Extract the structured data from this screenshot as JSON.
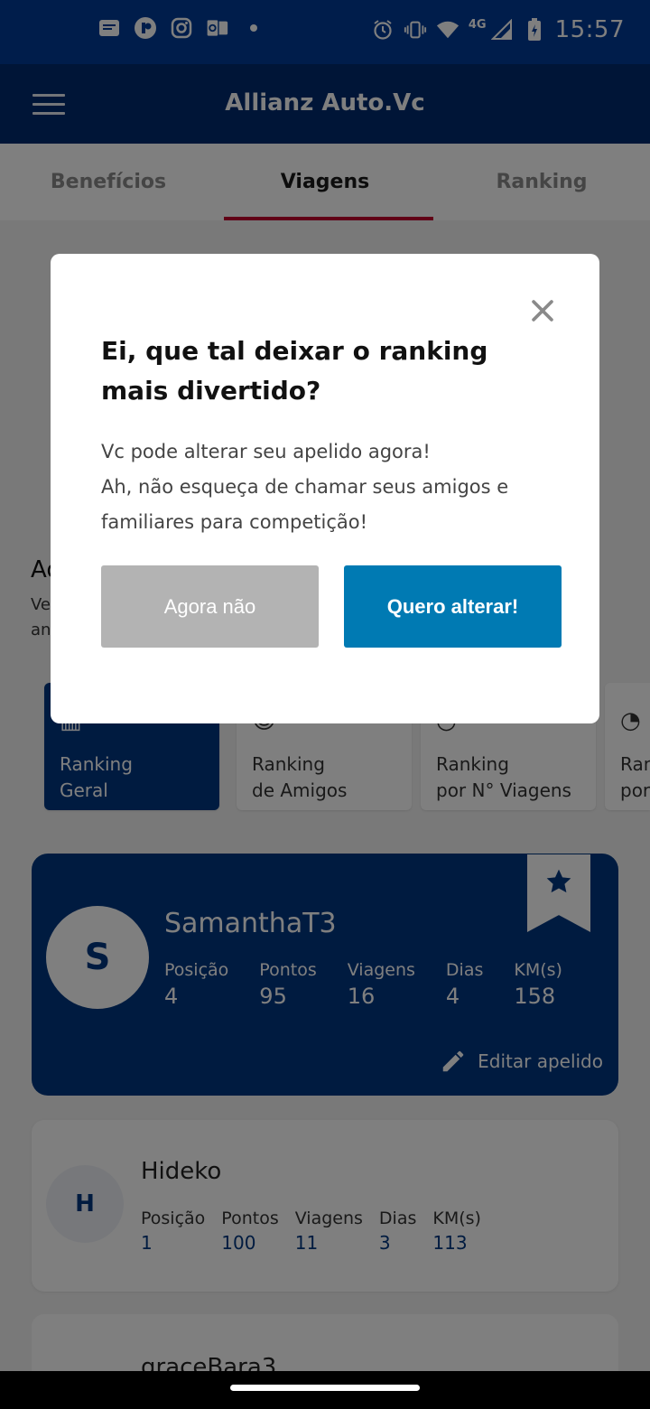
{
  "status_bar": {
    "time": "15:57",
    "network": "4G",
    "left_icons": [
      "notification-icon",
      "app-icon",
      "instagram-icon",
      "outlook-icon",
      "dot-icon"
    ],
    "right_icons": [
      "alarm-icon",
      "vibrate-icon",
      "wifi-icon",
      "signal-icon",
      "battery-charging-icon"
    ]
  },
  "app_bar": {
    "title": "Allianz Auto.Vc"
  },
  "tabs": [
    {
      "label": "Benefícios",
      "active": false
    },
    {
      "label": "Viagens",
      "active": true
    },
    {
      "label": "Ranking",
      "active": false
    }
  ],
  "background": {
    "section_title": "Ad",
    "section_sub": "Ve an"
  },
  "ranking_filters": [
    {
      "line1": "Ranking",
      "line2": "Geral",
      "active": true
    },
    {
      "line1": "Ranking",
      "line2": "de Amigos",
      "active": false
    },
    {
      "line1": "Ranking",
      "line2": "por N° Viagens",
      "active": false
    },
    {
      "line1": "Ran",
      "line2": "por",
      "active": false
    }
  ],
  "user_card": {
    "initial": "S",
    "name": "SamanthaT3",
    "stats": [
      {
        "label": "Posição",
        "value": "4"
      },
      {
        "label": "Pontos",
        "value": "95"
      },
      {
        "label": "Viagens",
        "value": "16"
      },
      {
        "label": "Dias",
        "value": "4"
      },
      {
        "label": "KM(s)",
        "value": "158"
      }
    ],
    "edit_label": "Editar apelido"
  },
  "other_user": {
    "initial": "H",
    "name": "Hideko",
    "stats": [
      {
        "label": "Posição",
        "value": "1"
      },
      {
        "label": "Pontos",
        "value": "100"
      },
      {
        "label": "Viagens",
        "value": "11"
      },
      {
        "label": "Dias",
        "value": "3"
      },
      {
        "label": "KM(s)",
        "value": "113"
      }
    ]
  },
  "third_user": {
    "name": "graceBara3"
  },
  "dialog": {
    "title": "Ei, que tal deixar o ranking mais divertido?",
    "body_line1": "Vc pode alterar seu apelido agora!",
    "body_line2": "Ah, não esqueça de chamar seus amigos e familiares para competição!",
    "secondary_button": "Agora não",
    "primary_button": "Quero alterar!"
  },
  "colors": {
    "status_bar": "#003a96",
    "app_bar": "#002a6e",
    "brand_blue": "#003781",
    "primary_button": "#007ab3",
    "secondary_button": "#b3b3b3",
    "tab_indicator": "#c2002f"
  }
}
